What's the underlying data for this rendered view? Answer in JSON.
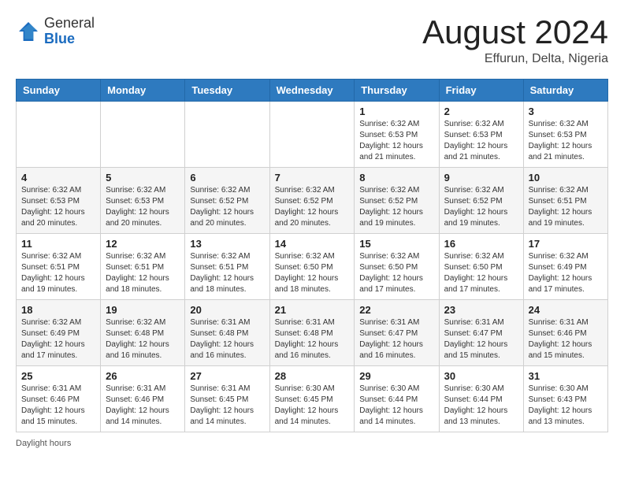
{
  "header": {
    "logo_general": "General",
    "logo_blue": "Blue",
    "month_year": "August 2024",
    "location": "Effurun, Delta, Nigeria"
  },
  "days_of_week": [
    "Sunday",
    "Monday",
    "Tuesday",
    "Wednesday",
    "Thursday",
    "Friday",
    "Saturday"
  ],
  "footer": {
    "daylight_hours": "Daylight hours"
  },
  "weeks": [
    [
      {
        "day": "",
        "info": ""
      },
      {
        "day": "",
        "info": ""
      },
      {
        "day": "",
        "info": ""
      },
      {
        "day": "",
        "info": ""
      },
      {
        "day": "1",
        "info": "Sunrise: 6:32 AM\nSunset: 6:53 PM\nDaylight: 12 hours and 21 minutes."
      },
      {
        "day": "2",
        "info": "Sunrise: 6:32 AM\nSunset: 6:53 PM\nDaylight: 12 hours and 21 minutes."
      },
      {
        "day": "3",
        "info": "Sunrise: 6:32 AM\nSunset: 6:53 PM\nDaylight: 12 hours and 21 minutes."
      }
    ],
    [
      {
        "day": "4",
        "info": "Sunrise: 6:32 AM\nSunset: 6:53 PM\nDaylight: 12 hours and 20 minutes."
      },
      {
        "day": "5",
        "info": "Sunrise: 6:32 AM\nSunset: 6:53 PM\nDaylight: 12 hours and 20 minutes."
      },
      {
        "day": "6",
        "info": "Sunrise: 6:32 AM\nSunset: 6:52 PM\nDaylight: 12 hours and 20 minutes."
      },
      {
        "day": "7",
        "info": "Sunrise: 6:32 AM\nSunset: 6:52 PM\nDaylight: 12 hours and 20 minutes."
      },
      {
        "day": "8",
        "info": "Sunrise: 6:32 AM\nSunset: 6:52 PM\nDaylight: 12 hours and 19 minutes."
      },
      {
        "day": "9",
        "info": "Sunrise: 6:32 AM\nSunset: 6:52 PM\nDaylight: 12 hours and 19 minutes."
      },
      {
        "day": "10",
        "info": "Sunrise: 6:32 AM\nSunset: 6:51 PM\nDaylight: 12 hours and 19 minutes."
      }
    ],
    [
      {
        "day": "11",
        "info": "Sunrise: 6:32 AM\nSunset: 6:51 PM\nDaylight: 12 hours and 19 minutes."
      },
      {
        "day": "12",
        "info": "Sunrise: 6:32 AM\nSunset: 6:51 PM\nDaylight: 12 hours and 18 minutes."
      },
      {
        "day": "13",
        "info": "Sunrise: 6:32 AM\nSunset: 6:51 PM\nDaylight: 12 hours and 18 minutes."
      },
      {
        "day": "14",
        "info": "Sunrise: 6:32 AM\nSunset: 6:50 PM\nDaylight: 12 hours and 18 minutes."
      },
      {
        "day": "15",
        "info": "Sunrise: 6:32 AM\nSunset: 6:50 PM\nDaylight: 12 hours and 17 minutes."
      },
      {
        "day": "16",
        "info": "Sunrise: 6:32 AM\nSunset: 6:50 PM\nDaylight: 12 hours and 17 minutes."
      },
      {
        "day": "17",
        "info": "Sunrise: 6:32 AM\nSunset: 6:49 PM\nDaylight: 12 hours and 17 minutes."
      }
    ],
    [
      {
        "day": "18",
        "info": "Sunrise: 6:32 AM\nSunset: 6:49 PM\nDaylight: 12 hours and 17 minutes."
      },
      {
        "day": "19",
        "info": "Sunrise: 6:32 AM\nSunset: 6:48 PM\nDaylight: 12 hours and 16 minutes."
      },
      {
        "day": "20",
        "info": "Sunrise: 6:31 AM\nSunset: 6:48 PM\nDaylight: 12 hours and 16 minutes."
      },
      {
        "day": "21",
        "info": "Sunrise: 6:31 AM\nSunset: 6:48 PM\nDaylight: 12 hours and 16 minutes."
      },
      {
        "day": "22",
        "info": "Sunrise: 6:31 AM\nSunset: 6:47 PM\nDaylight: 12 hours and 16 minutes."
      },
      {
        "day": "23",
        "info": "Sunrise: 6:31 AM\nSunset: 6:47 PM\nDaylight: 12 hours and 15 minutes."
      },
      {
        "day": "24",
        "info": "Sunrise: 6:31 AM\nSunset: 6:46 PM\nDaylight: 12 hours and 15 minutes."
      }
    ],
    [
      {
        "day": "25",
        "info": "Sunrise: 6:31 AM\nSunset: 6:46 PM\nDaylight: 12 hours and 15 minutes."
      },
      {
        "day": "26",
        "info": "Sunrise: 6:31 AM\nSunset: 6:46 PM\nDaylight: 12 hours and 14 minutes."
      },
      {
        "day": "27",
        "info": "Sunrise: 6:31 AM\nSunset: 6:45 PM\nDaylight: 12 hours and 14 minutes."
      },
      {
        "day": "28",
        "info": "Sunrise: 6:30 AM\nSunset: 6:45 PM\nDaylight: 12 hours and 14 minutes."
      },
      {
        "day": "29",
        "info": "Sunrise: 6:30 AM\nSunset: 6:44 PM\nDaylight: 12 hours and 14 minutes."
      },
      {
        "day": "30",
        "info": "Sunrise: 6:30 AM\nSunset: 6:44 PM\nDaylight: 12 hours and 13 minutes."
      },
      {
        "day": "31",
        "info": "Sunrise: 6:30 AM\nSunset: 6:43 PM\nDaylight: 12 hours and 13 minutes."
      }
    ]
  ]
}
